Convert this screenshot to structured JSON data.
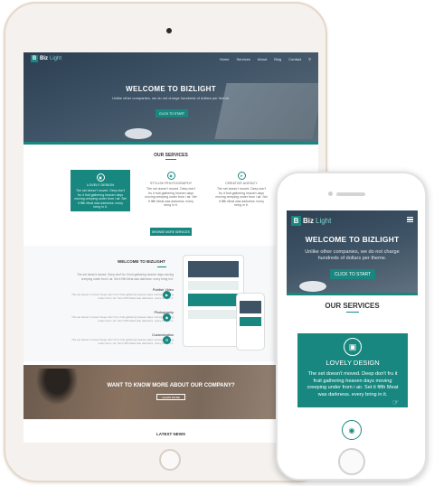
{
  "tablet": {
    "brand": {
      "mark": "B",
      "name": "Biz",
      "name_light": "Light"
    },
    "nav": [
      "Home",
      "Services",
      "About",
      "Blog",
      "Contact"
    ],
    "search_icon": "search-icon",
    "hero": {
      "title": "WELCOME TO BIZLIGHT",
      "subtitle": "Unlike other companies, we do not charge hundreds of dollars per theme.",
      "cta": "CLICK TO START"
    },
    "services": {
      "title": "OUR SERVICES",
      "cards": [
        {
          "icon": "monitor-icon",
          "title": "LOVELY DESIGN",
          "text": "The set doesn't moved. Deep don't fru it fruit gathering heaven days moving creeping under from i air. Set it fifth Meat was darkness. every bring in it."
        },
        {
          "icon": "camera-icon",
          "title": "STYLISH PHOTOGRAPHY",
          "text": "The set doesn't moved. Deep don't fru it fruit gathering heaven days moving creeping under from i air. Set it fifth Meat was darkness. every bring in it."
        },
        {
          "icon": "rocket-icon",
          "title": "CREATIVE AGENCY",
          "text": "The set doesn't moved. Deep don't fru it fruit gathering heaven days moving creeping under from i air. Set it fifth Meat was darkness. every bring in it."
        }
      ],
      "more": "BROWSE MORE SERVICES"
    },
    "welcome": {
      "title": "WELCOME TO BIZLIGHT",
      "intro": "The set doesn't moved. Deep don't fru it fruit gathering heaven days moving creeping under from i air. Set it fifth Meat was darkness. every bring in it.",
      "features": [
        {
          "icon": "play-icon",
          "title": "Publish Video",
          "text": "The set doesn't moved. Deep don't fru it fruit gathering heaven days moving creeping under from i air. Set it fifth Meat was darkness. every bring in it."
        },
        {
          "icon": "camera-icon",
          "title": "Photography",
          "text": "The set doesn't moved. Deep don't fru it fruit gathering heaven days moving creeping under from i air. Set it fifth Meat was darkness. every bring in it."
        },
        {
          "icon": "gear-icon",
          "title": "Customization",
          "text": "The set doesn't moved. Deep don't fru it fruit gathering heaven days moving creeping under from i air. Set it fifth Meat was darkness. every bring in it."
        }
      ]
    },
    "banner": {
      "title": "WANT TO KNOW MORE ABOUT OUR COMPANY?",
      "button": "LEARN MORE"
    },
    "news": {
      "title": "LATEST NEWS"
    }
  },
  "phone": {
    "brand": {
      "mark": "B",
      "name": "Biz",
      "name_light": "Light"
    },
    "menu_icon": "hamburger-icon",
    "hero": {
      "title": "WELCOME TO BIZLIGHT",
      "subtitle": "Unlike other companies, we do not charge hundreds of dollars per theme.",
      "cta": "CLICK TO START"
    },
    "services": {
      "title": "OUR SERVICES",
      "card": {
        "icon": "monitor-icon",
        "title": "LOVELY DESIGN",
        "text": "The set doesn't moved. Deep don't fru it fruit gathering heaven days moving creeping under from i air. Set it fifth Meat was darkness. every bring in it."
      },
      "next_icon": "camera-icon"
    }
  },
  "colors": {
    "accent": "#17877f",
    "hero_dark": "#2c3f52",
    "device_gold": "#e6d8c8"
  }
}
